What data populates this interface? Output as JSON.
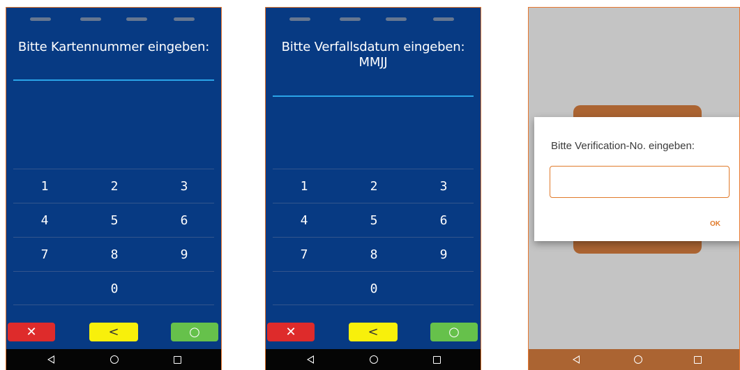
{
  "screens": [
    {
      "prompt": "Bitte Kartennummer eingeben:",
      "keys": [
        [
          "1",
          "2",
          "3"
        ],
        [
          "4",
          "5",
          "6"
        ],
        [
          "7",
          "8",
          "9"
        ],
        [
          "",
          "0",
          ""
        ]
      ],
      "buttons": {
        "cancel": "✕",
        "back": "<",
        "ok": "○"
      }
    },
    {
      "prompt": "Bitte Verfallsdatum eingeben:\nMMJJ",
      "keys": [
        [
          "1",
          "2",
          "3"
        ],
        [
          "4",
          "5",
          "6"
        ],
        [
          "7",
          "8",
          "9"
        ],
        [
          "",
          "0",
          ""
        ]
      ],
      "buttons": {
        "cancel": "✕",
        "back": "<",
        "ok": "○"
      }
    },
    {
      "dialog": {
        "title": "Bitte Verification-No. eingeben:",
        "input_value": "",
        "ok_label": "OK"
      }
    }
  ],
  "navbar": {
    "back_icon": "back-triangle-icon",
    "home_icon": "home-circle-icon",
    "recent_icon": "recents-square-icon"
  },
  "colors": {
    "terminal_background": "#073a83",
    "frame_border": "#e8772e",
    "entry_line": "#2aa4e8",
    "cancel": "#de2b2b",
    "back": "#f8f00b",
    "ok": "#66c14b",
    "dialog_accent": "#e07a2a",
    "app_brown": "#ab6432"
  }
}
